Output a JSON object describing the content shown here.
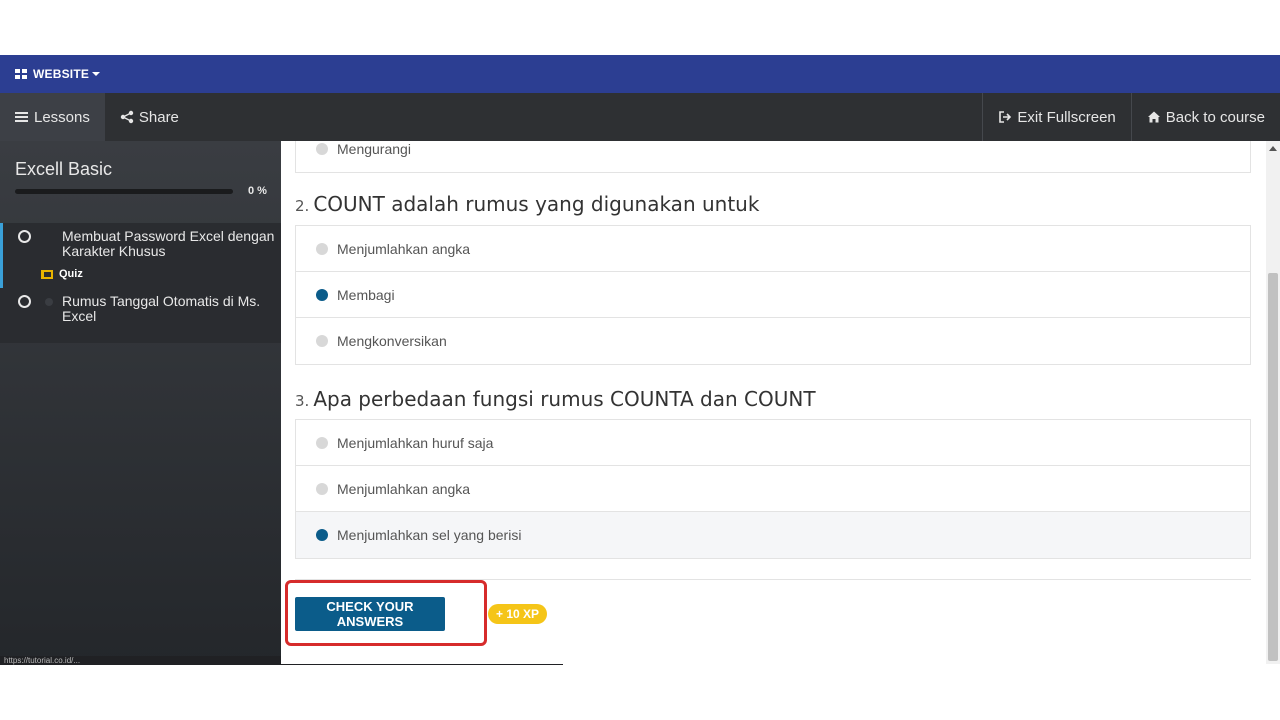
{
  "topbar": {
    "label": "WEBSITE"
  },
  "nav": {
    "lessons": "Lessons",
    "share": "Share",
    "exit_fullscreen": "Exit Fullscreen",
    "back_to_course": "Back to course"
  },
  "sidebar": {
    "course_title": "Excell Basic",
    "progress_percent": 0,
    "progress_label": "0 %",
    "lessons": [
      {
        "title": "Membuat Password Excel dengan Karakter Khusus",
        "tag": "Quiz"
      },
      {
        "title": "Rumus Tanggal Otomatis di Ms. Excel"
      }
    ]
  },
  "status_url": "https://tutorial.co.id/...",
  "quiz": {
    "partial_option": "Mengurangi",
    "questions": [
      {
        "number": "2.",
        "title": "COUNT adalah rumus yang digunakan untuk",
        "options": [
          {
            "label": "Menjumlahkan angka",
            "selected": false
          },
          {
            "label": "Membagi",
            "selected": true
          },
          {
            "label": "Mengkonversikan",
            "selected": false
          }
        ]
      },
      {
        "number": "3.",
        "title": "Apa perbedaan fungsi rumus COUNTA dan COUNT",
        "options": [
          {
            "label": "Menjumlahkan huruf saja",
            "selected": false
          },
          {
            "label": "Menjumlahkan angka",
            "selected": false
          },
          {
            "label": "Menjumlahkan sel yang berisi",
            "selected": true
          }
        ]
      }
    ],
    "check_button": "CHECK YOUR ANSWERS",
    "xp_badge": "+ 10 XP"
  },
  "colors": {
    "topbar": "#2c3e92",
    "navbar": "#2e3033",
    "accent": "#0b5c8a",
    "xp": "#f5c518",
    "highlight": "#d62b2b"
  }
}
